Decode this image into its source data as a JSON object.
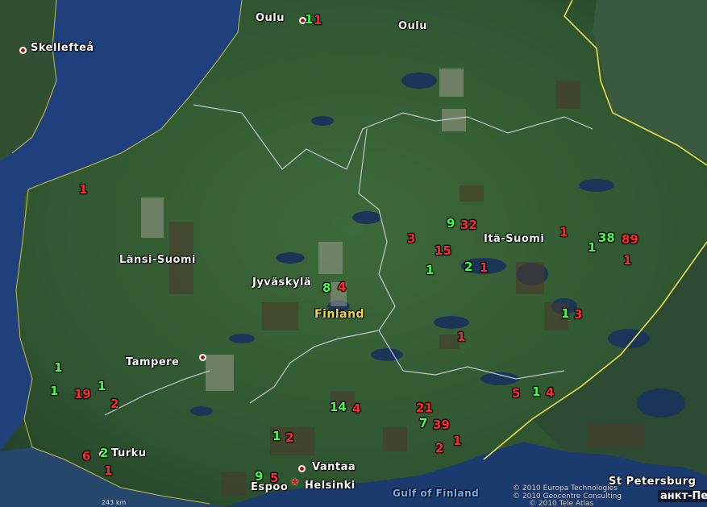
{
  "cities": {
    "oulu_city": "Oulu",
    "skelleftea": "Skellefteå",
    "jyvaskyla": "Jyväskylä",
    "tampere": "Tampere",
    "turku": "Turku",
    "vantaa": "Vantaa",
    "espoo": "Espoo",
    "helsinki": "Helsinki",
    "st_petersburg": "St Petersburg"
  },
  "regions": {
    "oulu": "Oulu",
    "lansi_suomi": "Länsi-Suomi",
    "ita_suomi": "Itä-Suomi"
  },
  "country": "Finland",
  "sea": "Gulf of Finland",
  "foreign_label": "анкт-Пе",
  "scale_text": "243 km",
  "attribution": [
    "© 2010 Europa Technologies",
    "© 2010 Geocentre Consulting",
    "© 2010 Tele Atlas"
  ],
  "counts": [
    {
      "text": "1",
      "color": "green"
    },
    {
      "text": "1",
      "color": "red"
    },
    {
      "text": "1",
      "color": "red"
    },
    {
      "text": "9",
      "color": "green"
    },
    {
      "text": "32",
      "color": "red"
    },
    {
      "text": "1",
      "color": "red"
    },
    {
      "text": "3",
      "color": "red"
    },
    {
      "text": "38",
      "color": "green"
    },
    {
      "text": "89",
      "color": "red"
    },
    {
      "text": "15",
      "color": "red"
    },
    {
      "text": "1",
      "color": "green"
    },
    {
      "text": "1",
      "color": "red"
    },
    {
      "text": "1",
      "color": "green"
    },
    {
      "text": "2",
      "color": "green"
    },
    {
      "text": "1",
      "color": "red"
    },
    {
      "text": "8",
      "color": "green"
    },
    {
      "text": "4",
      "color": "red"
    },
    {
      "text": "1",
      "color": "green"
    },
    {
      "text": "3",
      "color": "red"
    },
    {
      "text": "1",
      "color": "red"
    },
    {
      "text": "1",
      "color": "green"
    },
    {
      "text": "1",
      "color": "green"
    },
    {
      "text": "1",
      "color": "green"
    },
    {
      "text": "19",
      "color": "red"
    },
    {
      "text": "2",
      "color": "red"
    },
    {
      "text": "5",
      "color": "red"
    },
    {
      "text": "1",
      "color": "green"
    },
    {
      "text": "4",
      "color": "red"
    },
    {
      "text": "21",
      "color": "red"
    },
    {
      "text": "14",
      "color": "green"
    },
    {
      "text": "4",
      "color": "red"
    },
    {
      "text": "7",
      "color": "green"
    },
    {
      "text": "39",
      "color": "red"
    },
    {
      "text": "1",
      "color": "green"
    },
    {
      "text": "2",
      "color": "red"
    },
    {
      "text": "2",
      "color": "red"
    },
    {
      "text": "1",
      "color": "red"
    },
    {
      "text": "6",
      "color": "red"
    },
    {
      "text": "2",
      "color": "green"
    },
    {
      "text": "1",
      "color": "red"
    },
    {
      "text": "9",
      "color": "green"
    },
    {
      "text": "5",
      "color": "red"
    }
  ],
  "colors": {
    "count_red": "#ff2a2a",
    "count_green": "#3cff4a",
    "border": "#e8e04a",
    "water": "#1d3d7a"
  }
}
